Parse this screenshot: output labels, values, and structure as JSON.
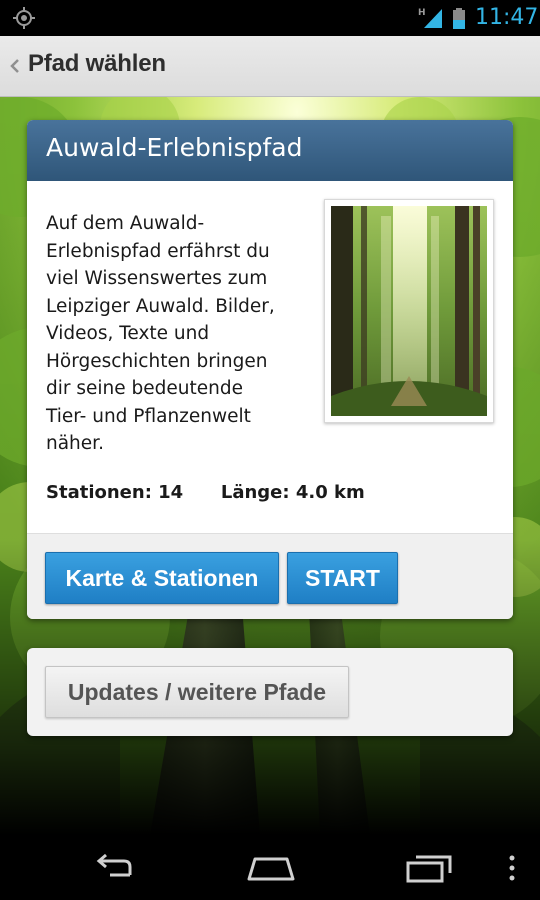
{
  "status_bar": {
    "time": "11:47",
    "network": "H",
    "icons": [
      "gps-icon",
      "signal-icon",
      "battery-icon"
    ],
    "accent_color": "#33b5e5"
  },
  "action_bar": {
    "title": "Pfad wählen",
    "back_icon": "chevron-left-icon"
  },
  "trail": {
    "title": "Auwald-Erlebnispfad",
    "description_lines": [
      "Auf dem Auwald-",
      "Erlebnispfad erfährst du",
      "viel Wissenswertes zum",
      "Leipziger Auwald. Bilder,",
      "Videos, Texte und",
      "Hörgeschichten bringen",
      "dir seine bedeutende",
      "Tier- und Pflanzenwelt",
      "näher."
    ],
    "stations_label": "Stationen: 14",
    "length_label": "Länge: 4.0 km",
    "buttons": {
      "map": "Karte & Stationen",
      "start": "START"
    },
    "header_color": "#3d6589",
    "button_color": "#2a8fd6"
  },
  "updates": {
    "button": "Updates / weitere Pfade"
  },
  "nav_bar": {
    "icons": [
      "back-icon",
      "home-icon",
      "recent-apps-icon",
      "menu-icon"
    ]
  }
}
